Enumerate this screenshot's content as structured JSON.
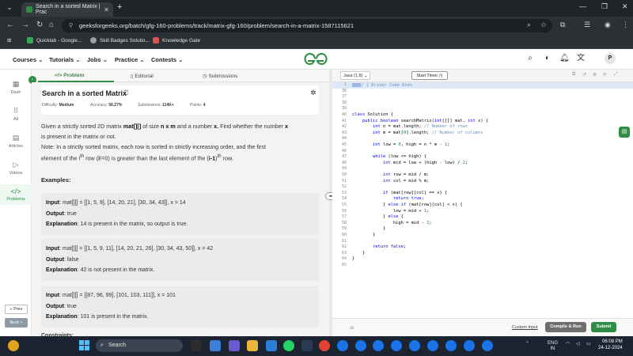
{
  "browser": {
    "tab_title": "Search in a sorted Matrix | Prac",
    "url": "geeksforgeeks.org/batch/gfg-160-problems/track/matrix-gfg-160/problem/search-in-a-matrix-1587115621",
    "bookmarks": [
      "Quicklab - Google...",
      "Skill Badges Solutio...",
      "Knowledge Gate"
    ]
  },
  "header": {
    "nav": [
      "Courses",
      "Tutorials",
      "Jobs",
      "Practice",
      "Contests"
    ],
    "avatar_letter": "P",
    "brand_color": "#2f8d46"
  },
  "sidebar": {
    "items": [
      {
        "label": "Dash",
        "icon": "dashboard-icon"
      },
      {
        "label": "All",
        "icon": "grid-icon"
      },
      {
        "label": "Articles",
        "icon": "article-icon"
      },
      {
        "label": "Videos",
        "icon": "video-icon"
      },
      {
        "label": "Problems",
        "icon": "code-icon"
      }
    ],
    "prev_label": "« Prev",
    "next_label": "Next »"
  },
  "problem": {
    "tabs": [
      "Problem",
      "Editorial",
      "Submissions"
    ],
    "title": "Search in a sorted Matrix",
    "difficulty_label": "Difficulty:",
    "difficulty": "Medium",
    "accuracy_label": "Accuracy:",
    "accuracy": "56.27%",
    "submissions_label": "Submissions:",
    "submissions": "114K+",
    "points_label": "Points:",
    "points": "4",
    "description_1a": "Given a strictly sorted 2D matrix ",
    "description_1b": "mat[][]",
    "description_1c": " of size ",
    "description_1d": "n x m",
    "description_1e": " and a number ",
    "description_1f": "x.",
    "description_1g": " Find whether the number ",
    "description_1h": "x",
    "description_2": "is present in the matrix or not.",
    "note_1": "Note: In a strictly sorted matrix, each row is sorted in strictly increasing order, and the first",
    "note_2a": "element of the i",
    "note_2b": "th",
    "note_2c": " row (",
    "note_2d": "i",
    "note_2e": "!=0) is greater than the last element of the (",
    "note_2f": "i-1",
    "note_2g": ")",
    "note_2h": "th",
    "note_2i": " row.",
    "examples_heading": "Examples:",
    "input_label": "Input",
    "output_label": "Output",
    "explanation_label": "Explanation",
    "examples": [
      {
        "input": "mat[][] = [[1, 5, 9], [14, 20, 21], [30, 34, 43]], x = 14",
        "output": "true",
        "explanation": "14 is present in the matrix, so output is true."
      },
      {
        "input": "mat[][] = [[1, 5, 9, 11], [14, 20, 21, 26], [30, 34, 43, 50]], x = 42",
        "output": "false",
        "explanation": "42 is not present in the matrix."
      },
      {
        "input": "mat[][] = [[87, 96, 99], [101, 103, 111]], x = 101",
        "output": "true",
        "explanation": "101 is present in the matrix."
      }
    ],
    "constraints_heading": "Constraints:"
  },
  "editor": {
    "language": "Java (1.8)",
    "timer_label": "Start Timer",
    "line_numbers": [
      "1",
      "36",
      "37",
      "38",
      "39",
      "40",
      "41",
      "42",
      "43",
      "44",
      "45",
      "46",
      "47",
      "48",
      "49",
      "50",
      "51",
      "52",
      "53",
      "54",
      "55",
      "56",
      "57",
      "58",
      "59",
      "60",
      "61",
      "62",
      "63",
      "64",
      "65"
    ],
    "first_line": "} Driver Code Ends",
    "custom_input_label": "Custom Input",
    "compile_label": "Compile & Run",
    "submit_label": "Submit"
  },
  "taskbar": {
    "search_placeholder": "Search",
    "lang_1": "ENG",
    "lang_2": "IN",
    "time": "06:08 PM",
    "date": "24-12-2024"
  }
}
